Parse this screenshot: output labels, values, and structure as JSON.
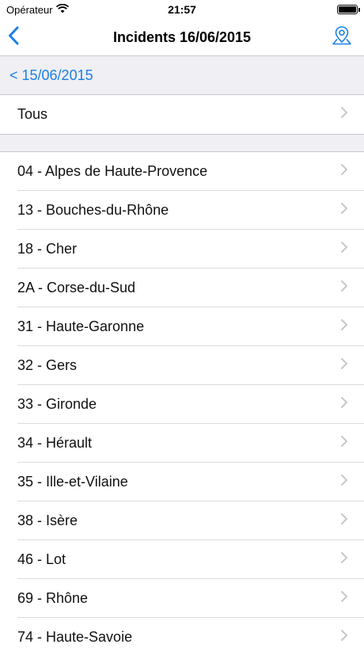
{
  "status_bar": {
    "carrier": "Opérateur",
    "time": "21:57"
  },
  "nav": {
    "title": "Incidents 16/06/2015",
    "back_icon": "chevron-left-icon",
    "map_icon": "map-pin-icon"
  },
  "sub_bar": {
    "prev_link": "< 15/06/2015"
  },
  "all_item": {
    "label": "Tous"
  },
  "departments": [
    {
      "label": "04 - Alpes de Haute-Provence"
    },
    {
      "label": "13 - Bouches-du-Rhône"
    },
    {
      "label": "18 - Cher"
    },
    {
      "label": "2A - Corse-du-Sud"
    },
    {
      "label": "31 - Haute-Garonne"
    },
    {
      "label": "32 - Gers"
    },
    {
      "label": "33 - Gironde"
    },
    {
      "label": "34 - Hérault"
    },
    {
      "label": "35 - Ille-et-Vilaine"
    },
    {
      "label": "38 - Isère"
    },
    {
      "label": "46 - Lot"
    },
    {
      "label": "69 - Rhône"
    },
    {
      "label": "74 - Haute-Savoie"
    }
  ],
  "colors": {
    "accent": "#1a80e6",
    "grouped_background": "#efeff4",
    "separator": "#dcdcde",
    "chevron": "#c7c7cc"
  }
}
